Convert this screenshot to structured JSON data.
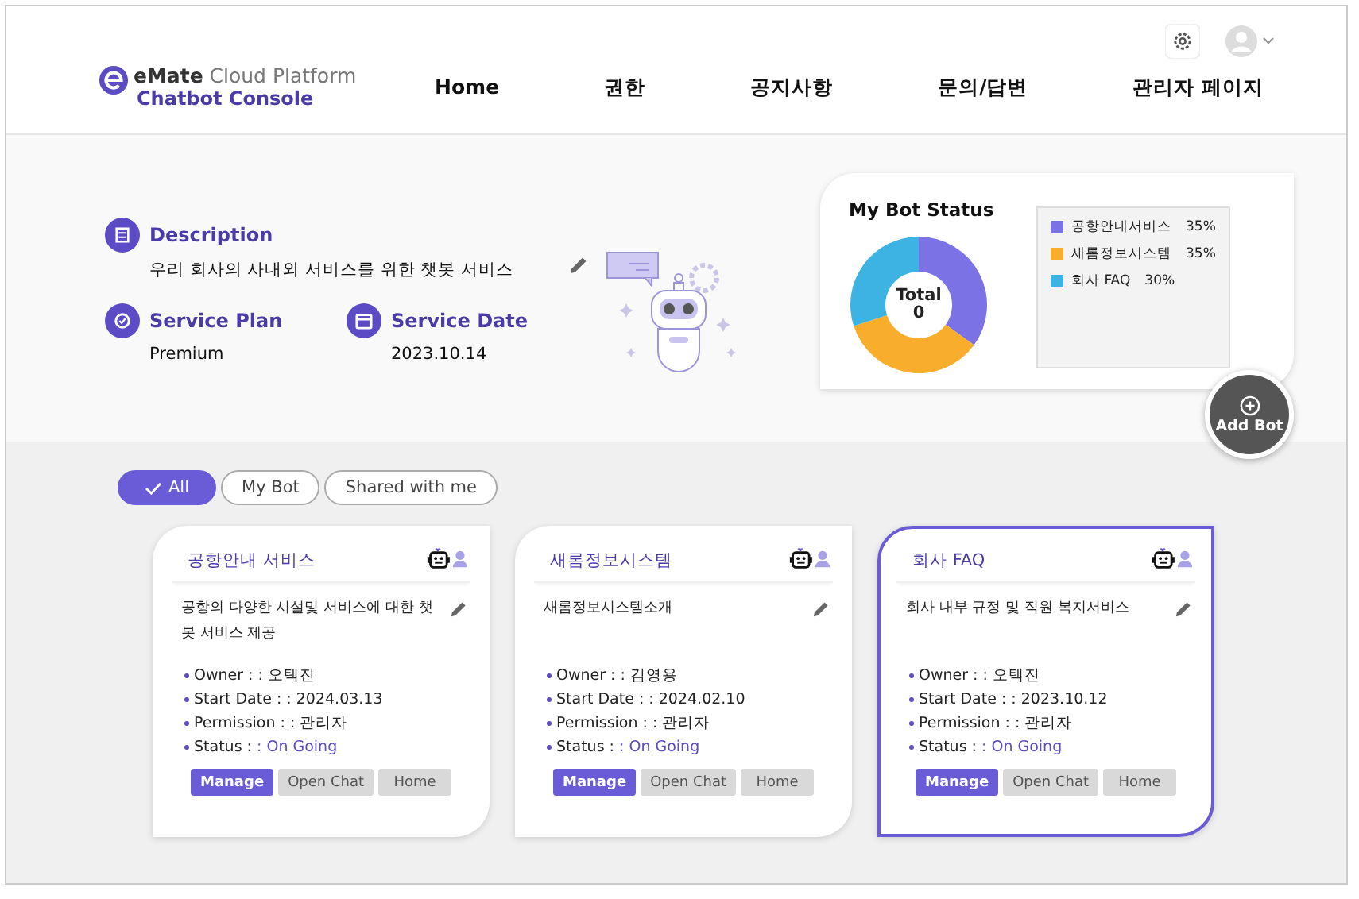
{
  "logo": {
    "brand": "eMate",
    "product": "Cloud Platform",
    "subtitle": "Chatbot Console"
  },
  "nav": [
    {
      "label": "Home"
    },
    {
      "label": "권한"
    },
    {
      "label": "공지사항"
    },
    {
      "label": "문의/답변"
    },
    {
      "label": "관리자 페이지"
    }
  ],
  "info": {
    "description_title": "Description",
    "description": "우리 회사의 사내외 서비스를 위한 챗봇 서비스",
    "plan_title": "Service Plan",
    "plan": "Premium",
    "date_title": "Service Date",
    "date": "2023.10.14"
  },
  "status": {
    "title": "My Bot Status",
    "total_label": "Total",
    "total": "0",
    "legend": [
      {
        "percent": "35%",
        "color": "#7b72e6"
      },
      {
        "percent": "35%",
        "color": "#f8ae2c"
      },
      {
        "percent": "30%",
        "color": "#3db3e3"
      }
    ],
    "chart_data": {
      "type": "donut",
      "categories": [
        "공항안내서비스",
        "새롬정보시스템",
        "회사 FAQ"
      ],
      "values": [
        35,
        35,
        30
      ]
    }
  },
  "add_bot": "Add Bot",
  "filters": [
    {
      "label": "All",
      "selected": true
    },
    {
      "label": "My Bot",
      "selected": false
    },
    {
      "label": "Shared with me",
      "selected": false
    }
  ],
  "bots": [
    {
      "name": "공항안내 서비스",
      "description": "공항의 다양한 시설및 서비스에 대한 챗봇 서비스 제공",
      "selected": false,
      "fields": [
        {
          "label": "Owner :",
          "value": ": 오택진"
        },
        {
          "label": "Start Date :",
          "value": ": 2024.03.13"
        },
        {
          "label": "Permission :",
          "value": ": 관리자"
        },
        {
          "label": "Status :",
          "value": ": On Going",
          "kind": "status"
        }
      ],
      "buttons": [
        "Manage",
        "Open Chat",
        "Home"
      ]
    },
    {
      "name": "새롬정보시스템",
      "description": "새롬정보시스템소개",
      "selected": false,
      "fields": [
        {
          "label": "Owner :",
          "value": ": 김영용"
        },
        {
          "label": "Start Date :",
          "value": ": 2024.02.10"
        },
        {
          "label": "Permission :",
          "value": ": 관리자"
        },
        {
          "label": "Status :",
          "value": ": On Going",
          "kind": "status"
        }
      ],
      "buttons": [
        "Manage",
        "Open Chat",
        "Home"
      ]
    },
    {
      "name": "회사 FAQ",
      "description": "회사 내부 규정 및 직원 복지서비스",
      "selected": true,
      "fields": [
        {
          "label": "Owner :",
          "value": ": 오택진"
        },
        {
          "label": "Start Date :",
          "value": ": 2023.10.12"
        },
        {
          "label": "Permission :",
          "value": ": 관리자"
        },
        {
          "label": "Status :",
          "value": ": On Going",
          "kind": "status"
        }
      ],
      "buttons": [
        "Manage",
        "Open Chat",
        "Home"
      ]
    }
  ]
}
